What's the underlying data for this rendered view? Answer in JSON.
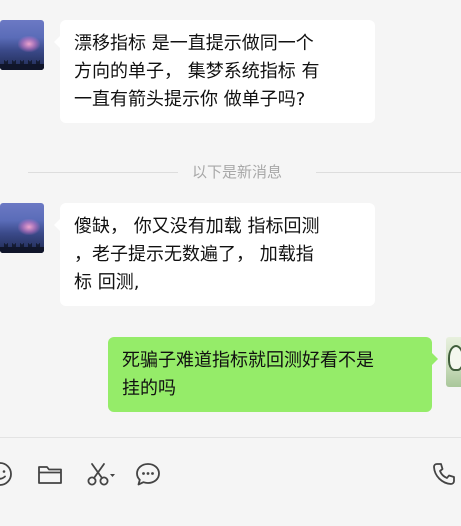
{
  "messages": [
    {
      "sender": "left",
      "lines": [
        "漂移指标 是一直提示做同一个",
        "方向的单子， 集梦系统指标 有",
        "一直有箭头提示你 做单子吗?"
      ]
    },
    {
      "sender": "left",
      "lines": [
        "傻缺， 你又没有加载 指标回测",
        "，老子提示无数遍了， 加载指",
        "标 回测,"
      ]
    },
    {
      "sender": "right",
      "lines": [
        "死骗子难道指标就回测好看不是",
        "挂的吗"
      ]
    }
  ],
  "divider": {
    "text": "以下是新消息"
  },
  "toolbar": {
    "icons": [
      "emoji-icon",
      "folder-icon",
      "scissors-icon",
      "chat-bubble-icon",
      "phone-icon"
    ]
  },
  "colors": {
    "background": "#f5f5f5",
    "bubble_left": "#ffffff",
    "bubble_right": "#95ec69",
    "divider_text": "#a8a8a8",
    "icon": "#444444"
  }
}
